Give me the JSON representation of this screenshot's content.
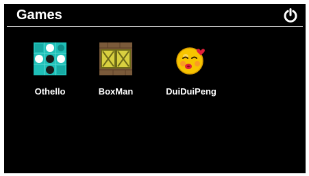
{
  "header": {
    "title": "Games"
  },
  "apps": [
    {
      "label": "Othello",
      "icon": "othello-board-icon"
    },
    {
      "label": "BoxMan",
      "icon": "boxman-crates-icon"
    },
    {
      "label": "DuiDuiPeng",
      "icon": "kissing-smiley-icon"
    }
  ],
  "colors": {
    "background": "#000000",
    "text": "#ffffff",
    "othello_board": "#1fbfb8",
    "crate": "#d8d040",
    "smiley": "#f7c400",
    "heart": "#e0203a"
  }
}
